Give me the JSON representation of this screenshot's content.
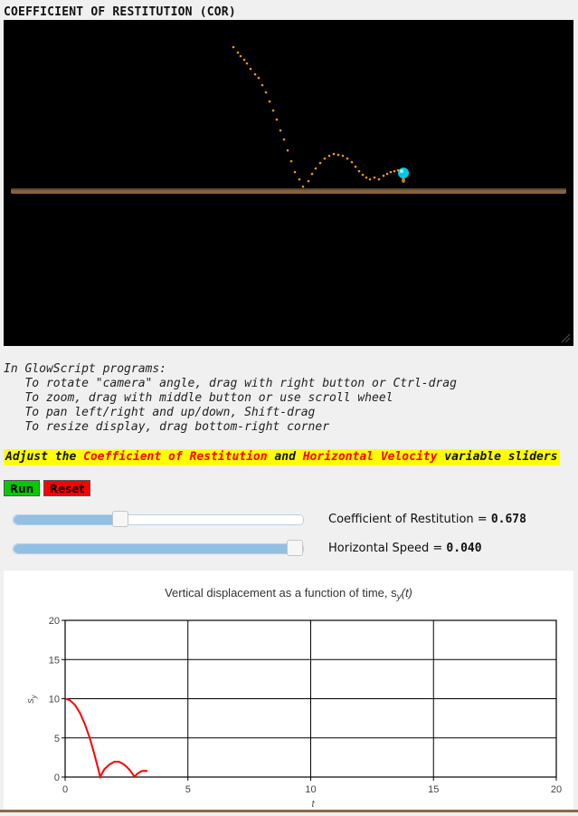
{
  "title": "COEFFICIENT OF RESTITUTION (COR)",
  "instructions": [
    "In GlowScript programs:",
    "   To rotate \"camera\" angle, drag with right button or Ctrl-drag",
    "   To zoom, drag with middle button or use scroll wheel",
    "   To pan left/right and up/down, Shift-drag",
    "   To resize display, drag bottom-right corner"
  ],
  "banner": {
    "prefix": "Adjust the ",
    "highlight1": "Coefficient of Restitution",
    "middle": " and ",
    "highlight2": "Horizontal Velocity",
    "suffix": " variable sliders"
  },
  "buttons": {
    "run": "Run",
    "reset": "Reset"
  },
  "sliders": [
    {
      "label": "Coefficient of Restitution = ",
      "value": "0.678",
      "fraction": 0.36
    },
    {
      "label": "Horizontal Speed = ",
      "value": "0.040",
      "fraction": 1.0
    }
  ],
  "colors": {
    "scene_bg": "#000000",
    "floor": "#8b5e3c",
    "trail": "#ff9900",
    "ball": "#00ccff",
    "banner_bg": "#ffff00",
    "banner_highlight": "#ff0000",
    "run_button": "#00cc00",
    "reset_button": "#ff0000",
    "curve": "#ff0000"
  },
  "chart_data": {
    "type": "line",
    "title": "Vertical displacement as a function of time, s",
    "title_sub": "y",
    "title_tail": "(t)",
    "xlabel": "t",
    "ylabel": "s",
    "ylabel_sub": "y",
    "xlim": [
      0,
      20
    ],
    "ylim": [
      0,
      20
    ],
    "xticks": [
      0,
      5,
      10,
      15,
      20
    ],
    "yticks": [
      0,
      5,
      10,
      15,
      20
    ],
    "grid": true,
    "series": [
      {
        "points": [
          [
            0,
            10
          ],
          [
            0.2,
            9.8
          ],
          [
            0.4,
            9.2
          ],
          [
            0.6,
            8.2
          ],
          [
            0.8,
            6.8
          ],
          [
            1.0,
            5.0
          ],
          [
            1.2,
            2.8
          ],
          [
            1.43,
            0.05
          ],
          [
            1.6,
            1.0
          ],
          [
            1.8,
            1.6
          ],
          [
            2.0,
            1.95
          ],
          [
            2.2,
            1.95
          ],
          [
            2.4,
            1.6
          ],
          [
            2.6,
            1.0
          ],
          [
            2.83,
            0.05
          ],
          [
            2.95,
            0.45
          ],
          [
            3.1,
            0.75
          ],
          [
            3.25,
            0.8
          ],
          [
            3.35,
            0.78
          ]
        ]
      }
    ]
  }
}
